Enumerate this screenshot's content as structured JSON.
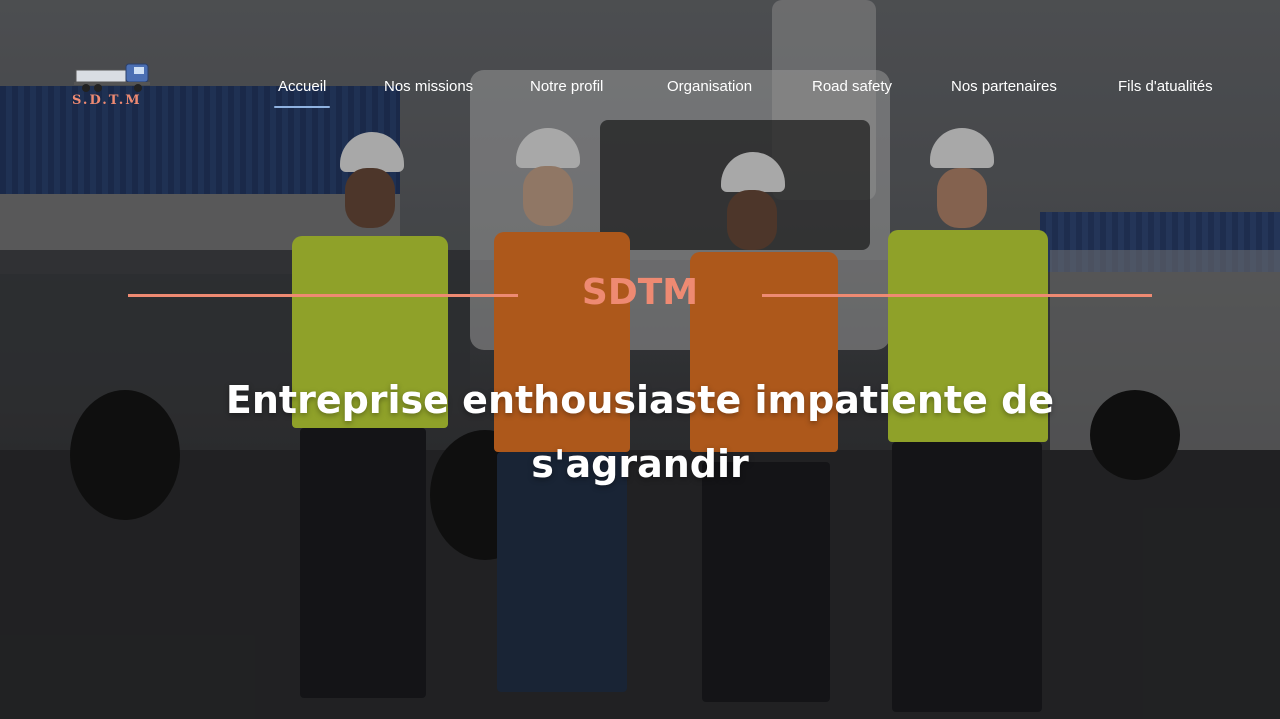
{
  "logo": {
    "text": "S.D.T.M",
    "icon": "truck-icon"
  },
  "nav": {
    "items": [
      {
        "label": "Accueil",
        "active": true
      },
      {
        "label": "Nos missions",
        "active": false
      },
      {
        "label": "Notre profil",
        "active": false
      },
      {
        "label": "Organisation",
        "active": false
      },
      {
        "label": "Road safety",
        "active": false
      },
      {
        "label": "Nos partenaires",
        "active": false
      },
      {
        "label": "Fils d'atualités",
        "active": false
      }
    ]
  },
  "hero": {
    "brand": "SDTM",
    "headline": "Entreprise enthousiaste impatiente de s'agrandir"
  },
  "colors": {
    "accent": "#ee8a72",
    "nav_underline": "#8fb2e0",
    "text": "#ffffff",
    "vest_yellow": "#c6e03a",
    "vest_orange": "#f07a26"
  }
}
